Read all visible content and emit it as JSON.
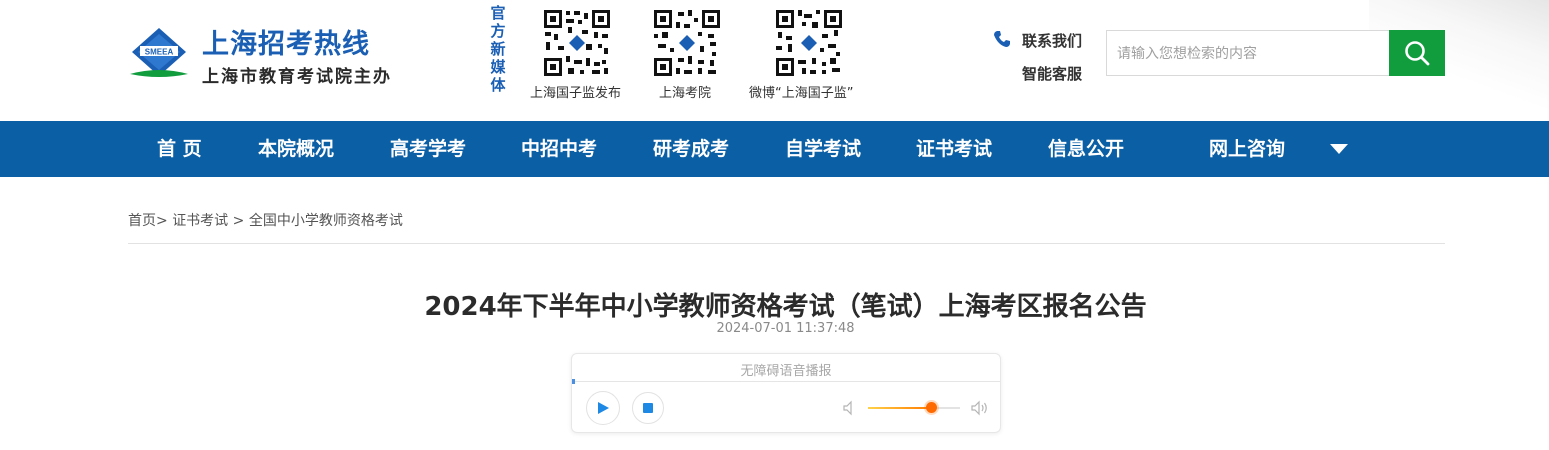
{
  "header": {
    "logo_title": "上海招考热线",
    "logo_subtitle": "上海市教育考试院主办",
    "logo_badge": "SMEEA",
    "media_label": "官方新媒体",
    "qr_codes": [
      {
        "caption": "上海国子监发布",
        "icon": "qr-code-icon"
      },
      {
        "caption": "上海考院",
        "icon": "qr-code-icon"
      },
      {
        "caption": "微博“上海国子监”",
        "icon": "qr-code-icon"
      }
    ],
    "contact_label": "联系我们",
    "service_label": "智能客服",
    "search_placeholder": "请输入您想检索的内容",
    "search_icon": "search-icon",
    "accent_color": "#119c3e"
  },
  "nav": {
    "items": [
      "首 页",
      "本院概况",
      "高考学考",
      "中招中考",
      "研考成考",
      "自学考试",
      "证书考试",
      "信息公开",
      "网上咨询"
    ],
    "background": "#0b5fa5"
  },
  "breadcrumb": {
    "home": "首页",
    "sep1": "> ",
    "level1": "证书考试",
    "sep2": " > ",
    "level2": "全国中小学教师资格考试"
  },
  "article": {
    "title": "2024年下半年中小学教师资格考试（笔试）上海考区报名公告",
    "date": "2024-07-01 11:37:48"
  },
  "player": {
    "title": "无障碍语音播报",
    "volume": 0.68
  }
}
